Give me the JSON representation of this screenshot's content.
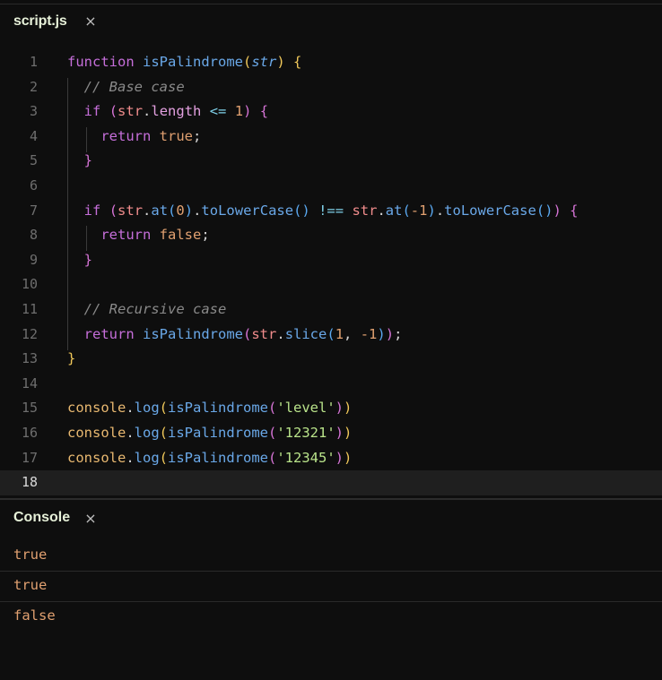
{
  "editor_tab": {
    "label": "script.js",
    "close_glyph": "×"
  },
  "editor": {
    "active_line": 18,
    "lines": [
      {
        "n": "1"
      },
      {
        "n": "2"
      },
      {
        "n": "3"
      },
      {
        "n": "4"
      },
      {
        "n": "5"
      },
      {
        "n": "6"
      },
      {
        "n": "7"
      },
      {
        "n": "8"
      },
      {
        "n": "9"
      },
      {
        "n": "10"
      },
      {
        "n": "11"
      },
      {
        "n": "12"
      },
      {
        "n": "13"
      },
      {
        "n": "14"
      },
      {
        "n": "15"
      },
      {
        "n": "16"
      },
      {
        "n": "17"
      },
      {
        "n": "18"
      }
    ],
    "tokens": {
      "kw_function": "function",
      "fn_name": "isPalindrome",
      "param": "str",
      "comment_base": "// Base case",
      "comment_recursive": "// Recursive case",
      "kw_if": "if",
      "kw_return": "return",
      "lit_true": "true",
      "lit_false": "false",
      "id_str": "str",
      "prop_length": "length",
      "op_le": "<=",
      "op_neq": "!==",
      "num_1": "1",
      "num_0": "0",
      "num_neg1": "-1",
      "method_at": "at",
      "method_lower": "toLowerCase",
      "method_slice": "slice",
      "console": "console",
      "method_log": "log",
      "str_level": "'level'",
      "str_12321": "'12321'",
      "str_12345": "'12345'"
    }
  },
  "console_panel": {
    "title": "Console",
    "close_glyph": "×",
    "output": [
      "true",
      "true",
      "false"
    ]
  },
  "colors": {
    "background": "#0e0e0e",
    "keyword": "#c56ed9",
    "function": "#6aa8e8",
    "string": "#b9e38a",
    "number": "#e0a070",
    "comment": "#8a8a8a",
    "bracket_gold": "#f0c85a"
  }
}
